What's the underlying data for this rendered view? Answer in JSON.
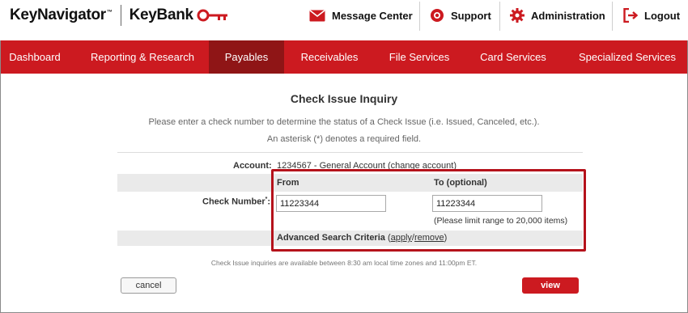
{
  "header": {
    "brand_primary": "KeyNavigator",
    "brand_tm": "™",
    "brand_secondary": "KeyBank",
    "utility_links": [
      {
        "label": "Message Center",
        "icon": "envelope-icon"
      },
      {
        "label": "Support",
        "icon": "lifebuoy-icon"
      },
      {
        "label": "Administration",
        "icon": "gear-icon"
      },
      {
        "label": "Logout",
        "icon": "logout-icon"
      }
    ]
  },
  "nav": {
    "items": [
      {
        "label": "Dashboard"
      },
      {
        "label": "Reporting & Research"
      },
      {
        "label": "Payables",
        "active": true
      },
      {
        "label": "Receivables"
      },
      {
        "label": "File Services"
      },
      {
        "label": "Card Services"
      },
      {
        "label": "Specialized Services"
      }
    ]
  },
  "page": {
    "title": "Check Issue Inquiry",
    "instructions": "Please enter a check number to determine the status of a Check Issue (i.e. Issued, Canceled, etc.).",
    "required_note": "An asterisk (*) denotes a required field."
  },
  "account": {
    "label": "Account:",
    "value": "1234567 - General Account",
    "change_link": "(change account)"
  },
  "check_range": {
    "from_header": "From",
    "to_header": "To (optional)",
    "label": "Check Number",
    "required_mark": "*",
    "label_colon": ":",
    "from_value": "11223344",
    "to_value": "11223344",
    "limit_note": "(Please limit range to 20,000 items)"
  },
  "advanced": {
    "label": "Advanced Search Criteria",
    "open_paren": " (",
    "apply_link": "apply",
    "slash": "/",
    "remove_link": "remove",
    "close_paren": ")"
  },
  "footer_note": "Check Issue inquiries are available between 8:30 am local time zones and 11:00pm ET.",
  "buttons": {
    "cancel": "cancel",
    "view": "view"
  },
  "colors": {
    "brand_red": "#cc1a20",
    "nav_active": "#8f1516",
    "highlight_border": "#b5121b"
  }
}
